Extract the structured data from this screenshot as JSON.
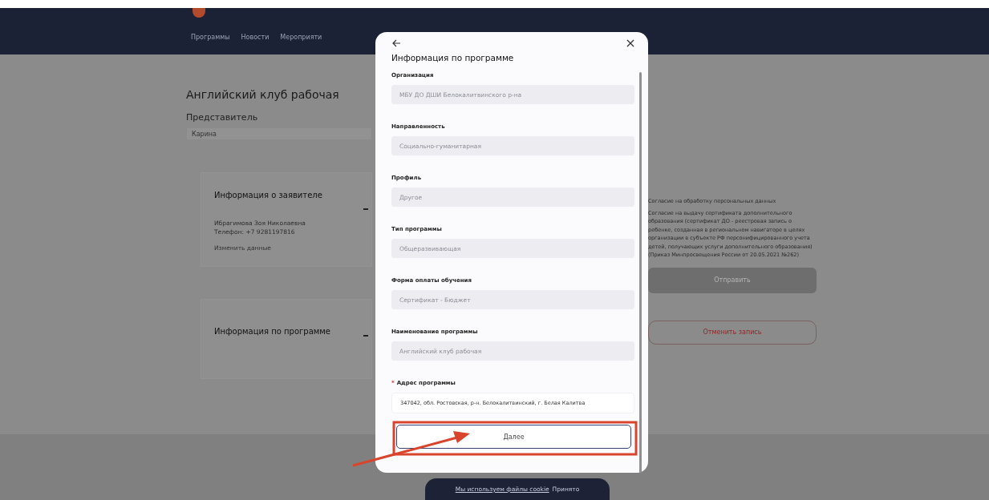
{
  "header": {
    "nav": [
      {
        "label": "Программы"
      },
      {
        "label": "Новости"
      },
      {
        "label": "Мероприяти"
      }
    ]
  },
  "page": {
    "title": "Английский клуб рабочая",
    "representative": {
      "label": "Представитель",
      "value": "Карина"
    },
    "cards": [
      {
        "title": "Информация о заявителе",
        "lines": [
          "Ибрагимова Зоя Николаевна",
          "Телефон: +7 9281197816"
        ],
        "link": "Изменить данные"
      },
      {
        "title": "Информация по программе"
      }
    ],
    "consents": [
      "Согласие на обработку персональных данных",
      "Согласие на выдачу сертификата дополнительного образования (сертификат ДО - реестровая запись о ребенке, созданная в региональном навигаторе в целях организации в субъекте РФ персонифицированного учета детей, получающих услуги дополнительного образования) (Приказ Минпросвещения России от 20.05.2021 №262)"
    ],
    "buttons": [
      {
        "label": "Отправить",
        "kind": "primary",
        "disabled": true
      },
      {
        "label": "Отменить запись",
        "kind": "outline"
      }
    ]
  },
  "modal": {
    "title": "Информация по программе",
    "fields": [
      {
        "label": "Организация",
        "value": "МБУ ДО ДШИ Белокалитвинского р-на",
        "disabled": true
      },
      {
        "label": "Направленность",
        "value": "Социально-гуманитарная",
        "disabled": true
      },
      {
        "label": "Профиль",
        "value": "Другое",
        "disabled": true
      },
      {
        "label": "Тип программы",
        "value": "Общеразвивающая",
        "disabled": true
      },
      {
        "label": "Форма оплаты обучения",
        "value": "Сертификат - Бюджет",
        "disabled": true
      },
      {
        "label": "Наименование программы",
        "value": "Английский клуб рабочая",
        "disabled": true
      },
      {
        "label": "Адрес программы",
        "value": "347042, обл. Ростовская, р-н. Белокалитвинский, г. Белая Калитва",
        "required_mark": "*",
        "disabled": false
      }
    ],
    "next_button": "Далее"
  },
  "cookie_bar": {
    "link": "Мы используем файлы cookie",
    "button": "Принято"
  }
}
